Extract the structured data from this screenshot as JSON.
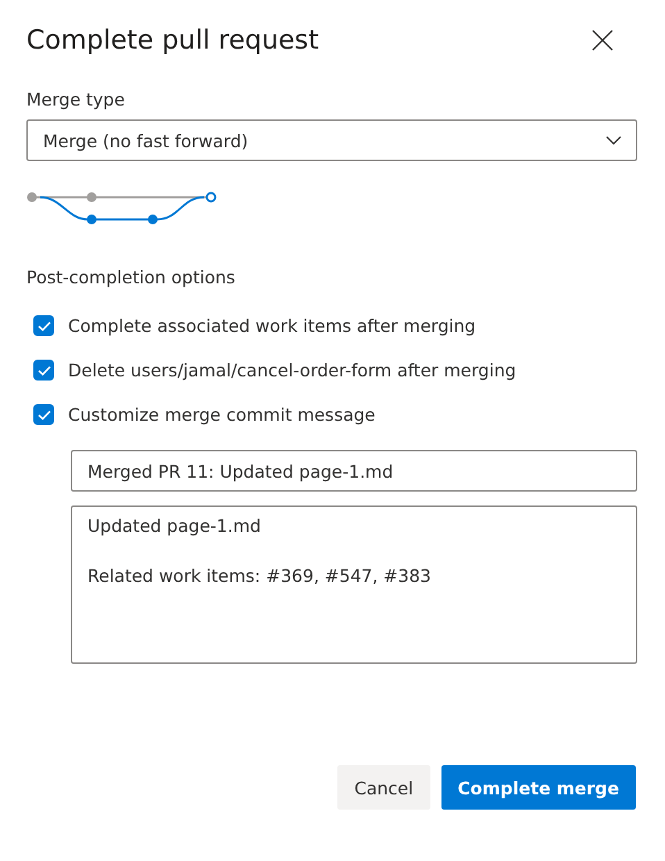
{
  "dialog": {
    "title": "Complete pull request"
  },
  "merge_type": {
    "label": "Merge type",
    "value": "Merge (no fast forward)"
  },
  "post_completion": {
    "label": "Post-completion options",
    "options": [
      {
        "label": "Complete associated work items after merging",
        "checked": true
      },
      {
        "label": "Delete users/jamal/cancel-order-form after merging",
        "checked": true
      },
      {
        "label": "Customize merge commit message",
        "checked": true
      }
    ]
  },
  "commit_title": {
    "value": "Merged PR 11: Updated page-1.md"
  },
  "commit_body": {
    "paragraphs": [
      "Updated page-1.md",
      "Related work items: #369, #547, #383"
    ]
  },
  "buttons": [
    {
      "label": "Cancel",
      "kind": "secondary"
    },
    {
      "label": "Complete merge",
      "kind": "primary"
    }
  ]
}
